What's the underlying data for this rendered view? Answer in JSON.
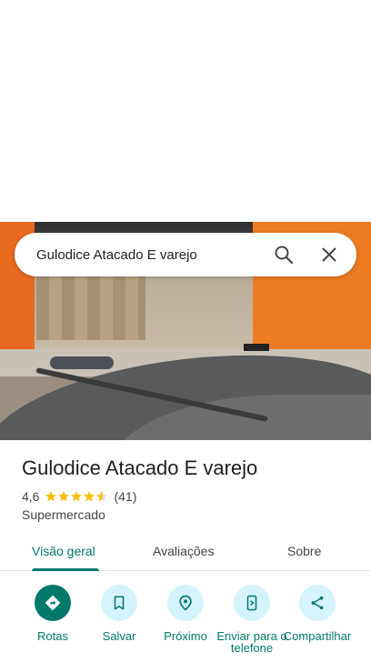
{
  "search": {
    "query": "Gulodice Atacado E varejo"
  },
  "place": {
    "name": "Gulodice Atacado E varejo",
    "rating": "4,6",
    "review_count": "(41)",
    "stars": 4.6,
    "category": "Supermercado"
  },
  "tabs": [
    {
      "label": "Visão geral",
      "active": true
    },
    {
      "label": "Avaliações",
      "active": false
    },
    {
      "label": "Sobre",
      "active": false
    }
  ],
  "actions": [
    {
      "label": "Rotas",
      "icon": "directions-icon"
    },
    {
      "label": "Salvar",
      "icon": "bookmark-icon"
    },
    {
      "label": "Próximo",
      "icon": "nearby-icon"
    },
    {
      "label": "Enviar para o telefone",
      "icon": "send-to-phone-icon"
    },
    {
      "label": "Compartilhar",
      "icon": "share-icon"
    }
  ],
  "colors": {
    "accent": "#00796b",
    "action_bg": "#d5f3fb",
    "star": "#fbbc04"
  }
}
